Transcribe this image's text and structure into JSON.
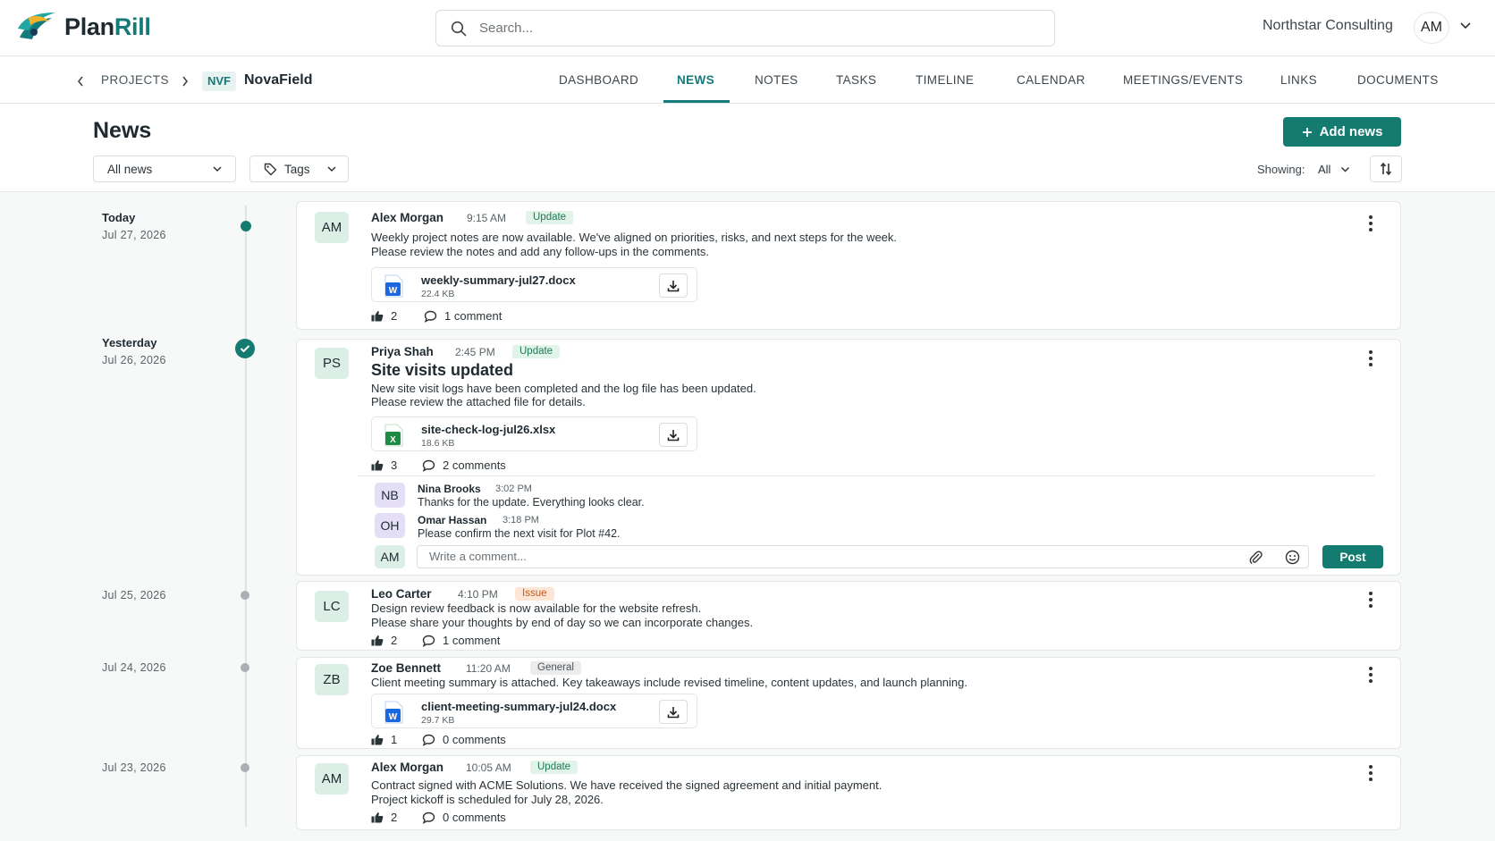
{
  "app": {
    "name_part1": "Plan",
    "name_part2": "Rill",
    "org": "Northstar Consulting",
    "user_initials": "AM"
  },
  "search": {
    "placeholder": "Search..."
  },
  "breadcrumb": {
    "projects": "PROJECTS",
    "code": "NVF",
    "name": "NovaField"
  },
  "tabs": [
    "DASHBOARD",
    "NEWS",
    "NOTES",
    "TASKS",
    "TIMELINE",
    "CALENDAR",
    "MEETINGS/EVENTS",
    "LINKS",
    "DOCUMENTS"
  ],
  "active_tab": "NEWS",
  "page": {
    "title": "News",
    "add_label": "Add news",
    "filter_all": "All news",
    "filter_tags": "Tags",
    "showing_label": "Showing:",
    "showing_value": "All"
  },
  "colors": {
    "accent": "#137b70",
    "tag_update": "#1d7a55",
    "tag_issue": "#c2581d"
  },
  "timeline": [
    {
      "label": "Today",
      "date": "Jul 27, 2026"
    },
    {
      "label": "Yesterday",
      "date": "Jul 26, 2026"
    },
    {
      "label": "",
      "date": "Jul 25, 2026"
    },
    {
      "label": "",
      "date": "Jul 24, 2026"
    },
    {
      "label": "",
      "date": "Jul 23, 2026"
    }
  ],
  "posts": [
    {
      "initials": "AM",
      "author": "Alex Morgan",
      "time": "9:15 AM",
      "tag": "Update",
      "lines": [
        "Weekly project notes are now available. We've aligned on priorities, risks, and next steps for the week.",
        "Please review the notes and add any follow-ups in the comments."
      ],
      "attachment": {
        "name": "weekly-summary-jul27.docx",
        "size": "22.4 KB",
        "type": "word"
      },
      "likes": "2",
      "comments": "1 comment"
    },
    {
      "initials": "PS",
      "author": "Priya Shah",
      "time": "2:45 PM",
      "tag": "Update",
      "title": "Site visits updated",
      "lines": [
        "New site visit logs have been completed and the log file has been updated.",
        "Please review the attached file for details."
      ],
      "attachment": {
        "name": "site-check-log-jul26.xlsx",
        "size": "18.6 KB",
        "type": "excel"
      },
      "likes": "3",
      "comments": "2 comments",
      "thread": [
        {
          "initials": "NB",
          "author": "Nina Brooks",
          "time": "3:02 PM",
          "text": "Thanks for the update. Everything looks clear."
        },
        {
          "initials": "OH",
          "author": "Omar Hassan",
          "time": "3:18 PM",
          "text": "Please confirm the next visit for Plot #42."
        }
      ],
      "reply": {
        "initials": "AM",
        "placeholder": "Write a comment...",
        "post_label": "Post"
      }
    },
    {
      "initials": "LC",
      "author": "Leo Carter",
      "time": "4:10 PM",
      "tag": "Issue",
      "lines": [
        "Design review feedback is now available for the website refresh.",
        "Please share your thoughts by end of day so we can incorporate changes."
      ],
      "likes": "2",
      "comments": "1 comment"
    },
    {
      "initials": "ZB",
      "author": "Zoe Bennett",
      "time": "11:20 AM",
      "tag": "General",
      "lines": [
        "Client meeting summary is attached. Key takeaways include revised timeline, content updates, and launch planning."
      ],
      "attachment": {
        "name": "client-meeting-summary-jul24.docx",
        "size": "29.7 KB",
        "type": "word"
      },
      "likes": "1",
      "comments": "0 comments"
    },
    {
      "initials": "AM",
      "author": "Alex Morgan",
      "time": "10:05 AM",
      "tag": "Update",
      "lines": [
        "Contract signed with ACME Solutions. We have received the signed agreement and initial payment.",
        "Project kickoff is scheduled for July 28, 2026."
      ],
      "likes": "2",
      "comments": "0 comments"
    }
  ]
}
